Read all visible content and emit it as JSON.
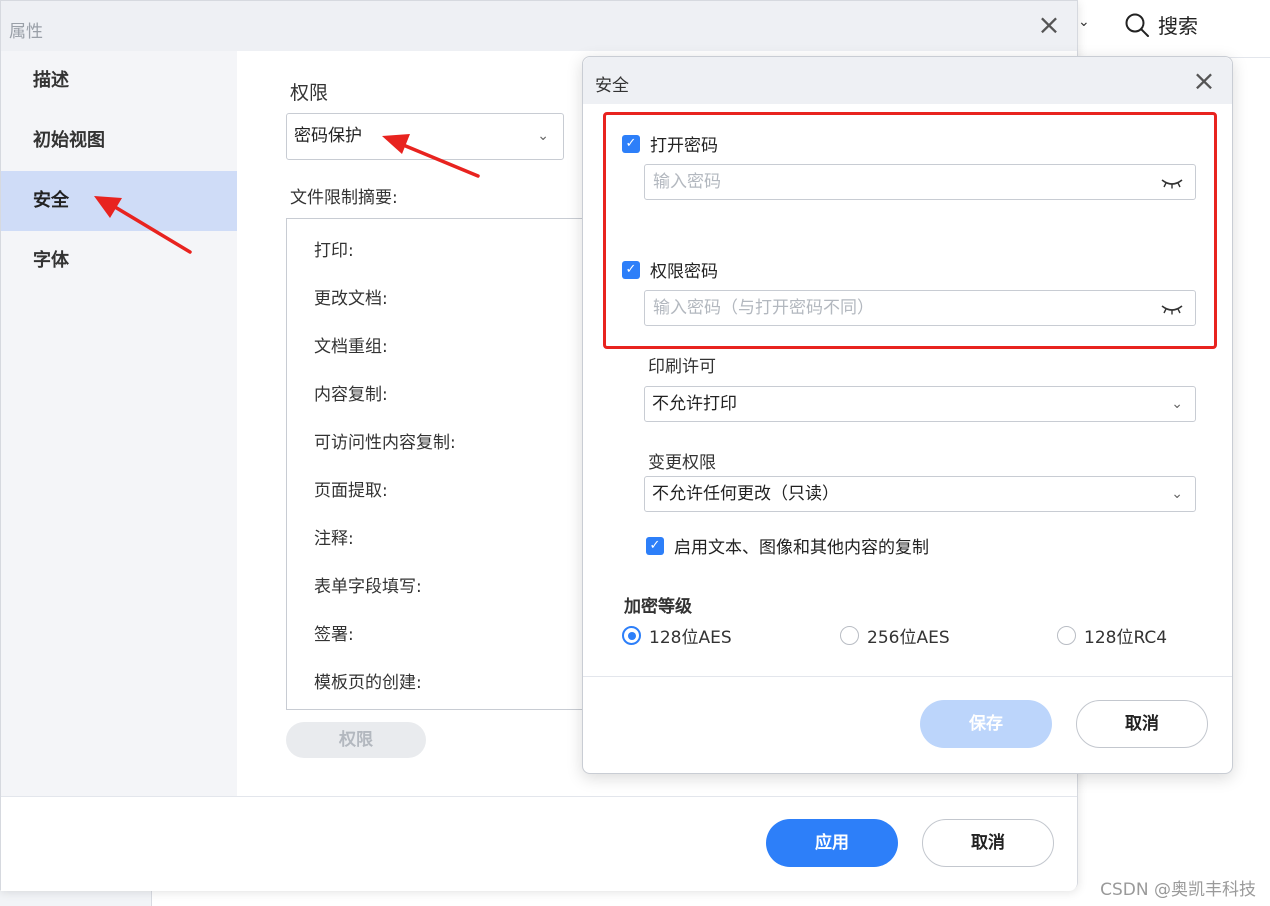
{
  "background_app": {
    "search_label": "搜索"
  },
  "props_dialog": {
    "title": "属性",
    "sidebar": [
      {
        "label": "描述"
      },
      {
        "label": "初始视图"
      },
      {
        "label": "安全",
        "active": true
      },
      {
        "label": "字体"
      }
    ],
    "permissions_label": "权限",
    "security_method": "密码保护",
    "summary_label": "文件限制摘要:",
    "summary_rows": [
      "打印:",
      "更改文档:",
      "文档重组:",
      "内容复制:",
      "可访问性内容复制:",
      "页面提取:",
      "注释:",
      "表单字段填写:",
      "签署:",
      "模板页的创建:"
    ],
    "permissions_button": "权限",
    "apply_button": "应用",
    "cancel_button": "取消"
  },
  "security_dialog": {
    "title": "安全",
    "open_password": {
      "label": "打开密码",
      "checked": true,
      "placeholder": "输入密码",
      "value": ""
    },
    "permission_password": {
      "label": "权限密码",
      "checked": true,
      "placeholder": "输入密码（与打开密码不同）",
      "value": ""
    },
    "print_label": "印刷许可",
    "print_value": "不允许打印",
    "change_label": "变更权限",
    "change_value": "不允许任何更改（只读）",
    "copy_option": {
      "label": "启用文本、图像和其他内容的复制",
      "checked": true
    },
    "encryption_label": "加密等级",
    "encryption_options": [
      {
        "label": "128位AES",
        "selected": true
      },
      {
        "label": "256位AES",
        "selected": false
      },
      {
        "label": "128位RC4",
        "selected": false
      }
    ],
    "save_button": "保存",
    "cancel_button": "取消"
  },
  "colors": {
    "accent": "#2d7ff9",
    "highlight_red": "#e8231f",
    "sidebar_active": "#cfdcf7"
  },
  "watermark": "CSDN @奥凯丰科技"
}
